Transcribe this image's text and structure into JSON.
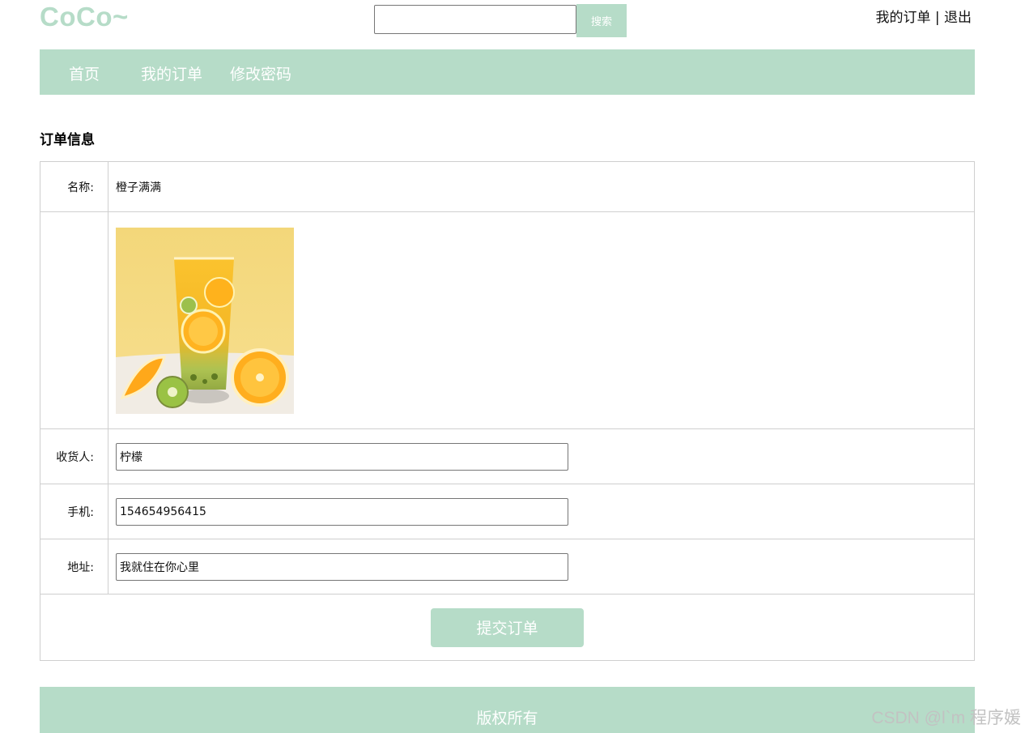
{
  "header": {
    "logo": "CoCo~",
    "search": {
      "value": "",
      "placeholder": "",
      "button_label": "搜索"
    },
    "my_orders_link": "我的订单",
    "separator": " | ",
    "logout_link": "退出"
  },
  "nav": {
    "items": [
      {
        "label": "首页"
      },
      {
        "label": "我的订单"
      },
      {
        "label": "修改密码"
      }
    ]
  },
  "order": {
    "section_title": "订单信息",
    "name_label": "名称:",
    "name_value": "橙子满满",
    "image_icon": "orange-kiwi-drink-image",
    "receiver_label": "收货人:",
    "receiver_value": "柠檬",
    "phone_label": "手机:",
    "phone_value": "154654956415",
    "address_label": "地址:",
    "address_value": "我就住在你心里",
    "submit_label": "提交订单"
  },
  "footer": {
    "text": "版权所有"
  },
  "watermark": "CSDN @l`m 程序媛",
  "colors": {
    "accent": "#b6dcc8",
    "border": "#cfcfcf"
  }
}
